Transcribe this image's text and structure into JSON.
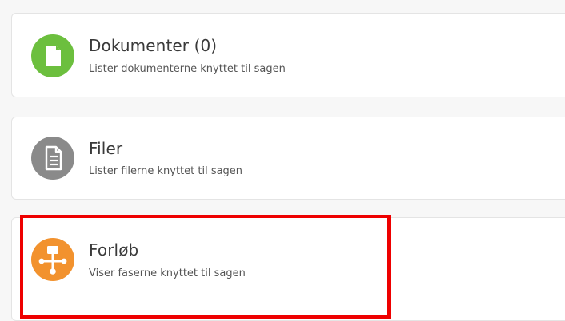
{
  "colors": {
    "documents_icon": "#6cbf3e",
    "files_icon": "#8a8a8a",
    "process_icon": "#f2922e",
    "highlight": "#ee0000"
  },
  "cards": [
    {
      "title": "Dokumenter (0)",
      "subtitle": "Lister dokumenterne knyttet til sagen",
      "icon": "document-icon"
    },
    {
      "title": "Filer",
      "subtitle": "Lister filerne knyttet til sagen",
      "icon": "file-icon"
    },
    {
      "title": "Forløb",
      "subtitle": "Viser faserne knyttet til sagen",
      "icon": "process-flow-icon"
    }
  ]
}
